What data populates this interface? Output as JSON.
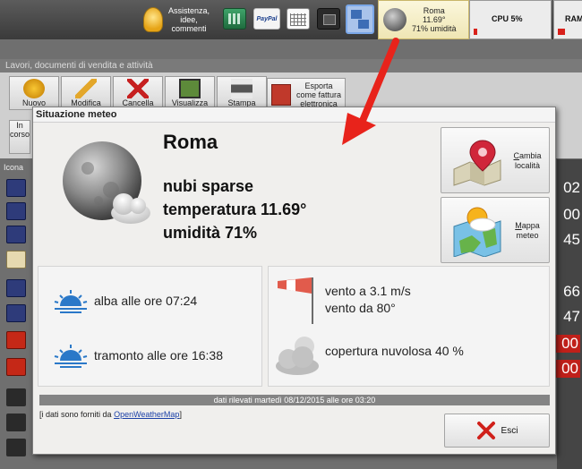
{
  "taskbar": {
    "assistance_lines": [
      "Assistenza,",
      "idee,",
      "commenti"
    ],
    "paypal_label": "PayPal",
    "weather_tile": {
      "city": "Roma",
      "temp": "11.69°",
      "humidity": "71% umidità"
    },
    "cpu_label": "CPU 5%",
    "cpu_level": 0.05,
    "ram_label": "RAM"
  },
  "app": {
    "caption": "Lavori, documenti di vendita e attività",
    "toolbar": {
      "nuovo": "Nuovo",
      "modifica": "Modifica",
      "cancella": "Cancella",
      "visualizza": "Visualizza",
      "stampa": "Stampa",
      "esporta_lines": [
        "Esporta",
        "come fattura",
        "elettronica"
      ],
      "in_corso": "In corso"
    },
    "grid_header": "Icona",
    "right_numbers": [
      "02",
      "00",
      "45",
      "66",
      "47",
      "00",
      "00"
    ]
  },
  "dialog": {
    "title": "Situazione meteo",
    "city": "Roma",
    "condition": "nubi sparse",
    "temperature": "temperatura 11.69°",
    "humidity": "umidità 71%",
    "change_location_lines": [
      "Cambia",
      "località"
    ],
    "weather_map_lines": [
      "Mappa",
      "meteo"
    ],
    "sunrise": "alba alle ore 07:24",
    "sunset": "tramonto alle ore 16:38",
    "wind_speed": "vento a 3.1 m/s",
    "wind_direction": "vento da 80°",
    "cloud_cover": "copertura nuvolosa 40 %",
    "timestamp": "dati rilevati martedì 08/12/2015 alle ore 03:20",
    "credits_prefix": "[i dati sono forniti da ",
    "credits_link": "OpenWeatherMap",
    "credits_suffix": "]",
    "close_label": "Esci"
  },
  "colors": {
    "accent_red": "#d8201a",
    "sun_icon_blue": "#2a78c8",
    "link_blue": "#1a3fa6"
  },
  "icons": {
    "weather_main": "moon-cloud-icon",
    "change_location": "map-pin-icon",
    "weather_map": "weather-map-icon",
    "sunrise": "sunrise-icon",
    "sunset": "sunset-icon",
    "wind": "windsock-icon",
    "cloud": "cloud-icon",
    "close": "close-icon"
  }
}
